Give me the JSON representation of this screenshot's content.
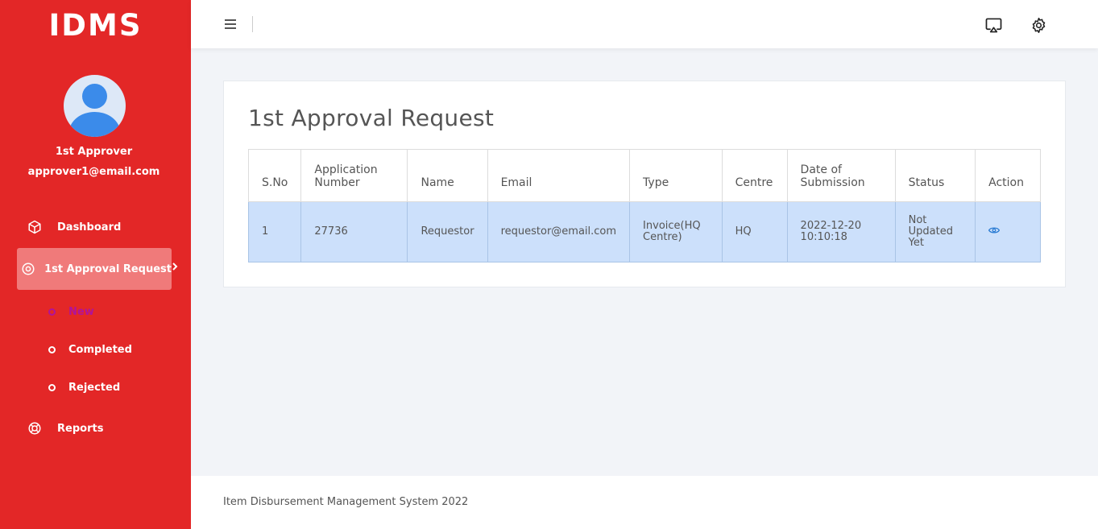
{
  "app": {
    "logo": "IDMS"
  },
  "user": {
    "name": "1st Approver",
    "email": "approver1@email.com"
  },
  "sidebar": {
    "items": [
      {
        "label": "Dashboard",
        "icon": "cube-icon"
      },
      {
        "label": "1st Approval Request",
        "icon": "target-icon",
        "active": true
      },
      {
        "label": "Reports",
        "icon": "lifebuoy-icon"
      }
    ],
    "submenu": [
      {
        "label": "New",
        "current": true
      },
      {
        "label": "Completed"
      },
      {
        "label": "Rejected"
      }
    ]
  },
  "topbar": {
    "menu_icon": "hamburger-icon",
    "cast_icon": "screen-cast-icon",
    "settings_icon": "gear-icon"
  },
  "page": {
    "title": "1st Approval Request",
    "table": {
      "headers": [
        "S.No",
        "Application Number",
        "Name",
        "Email",
        "Type",
        "Centre",
        "Date of Submission",
        "Status",
        "Action"
      ],
      "rows": [
        {
          "sno": "1",
          "application_number": "27736",
          "name": "Requestor",
          "email": "requestor@email.com",
          "type": "Invoice(HQ Centre)",
          "centre": "HQ",
          "date": "2022-12-20 10:10:18",
          "status": "Not Updated Yet",
          "action_icon": "eye-icon"
        }
      ]
    }
  },
  "footer": {
    "text": "Item Disbursement Management System 2022"
  },
  "colors": {
    "sidebar": "#e32727",
    "active_item": "#f07a7a",
    "row_highlight": "#cce0fb",
    "current_sub": "#b0139b",
    "eye": "#2b7cd3"
  }
}
